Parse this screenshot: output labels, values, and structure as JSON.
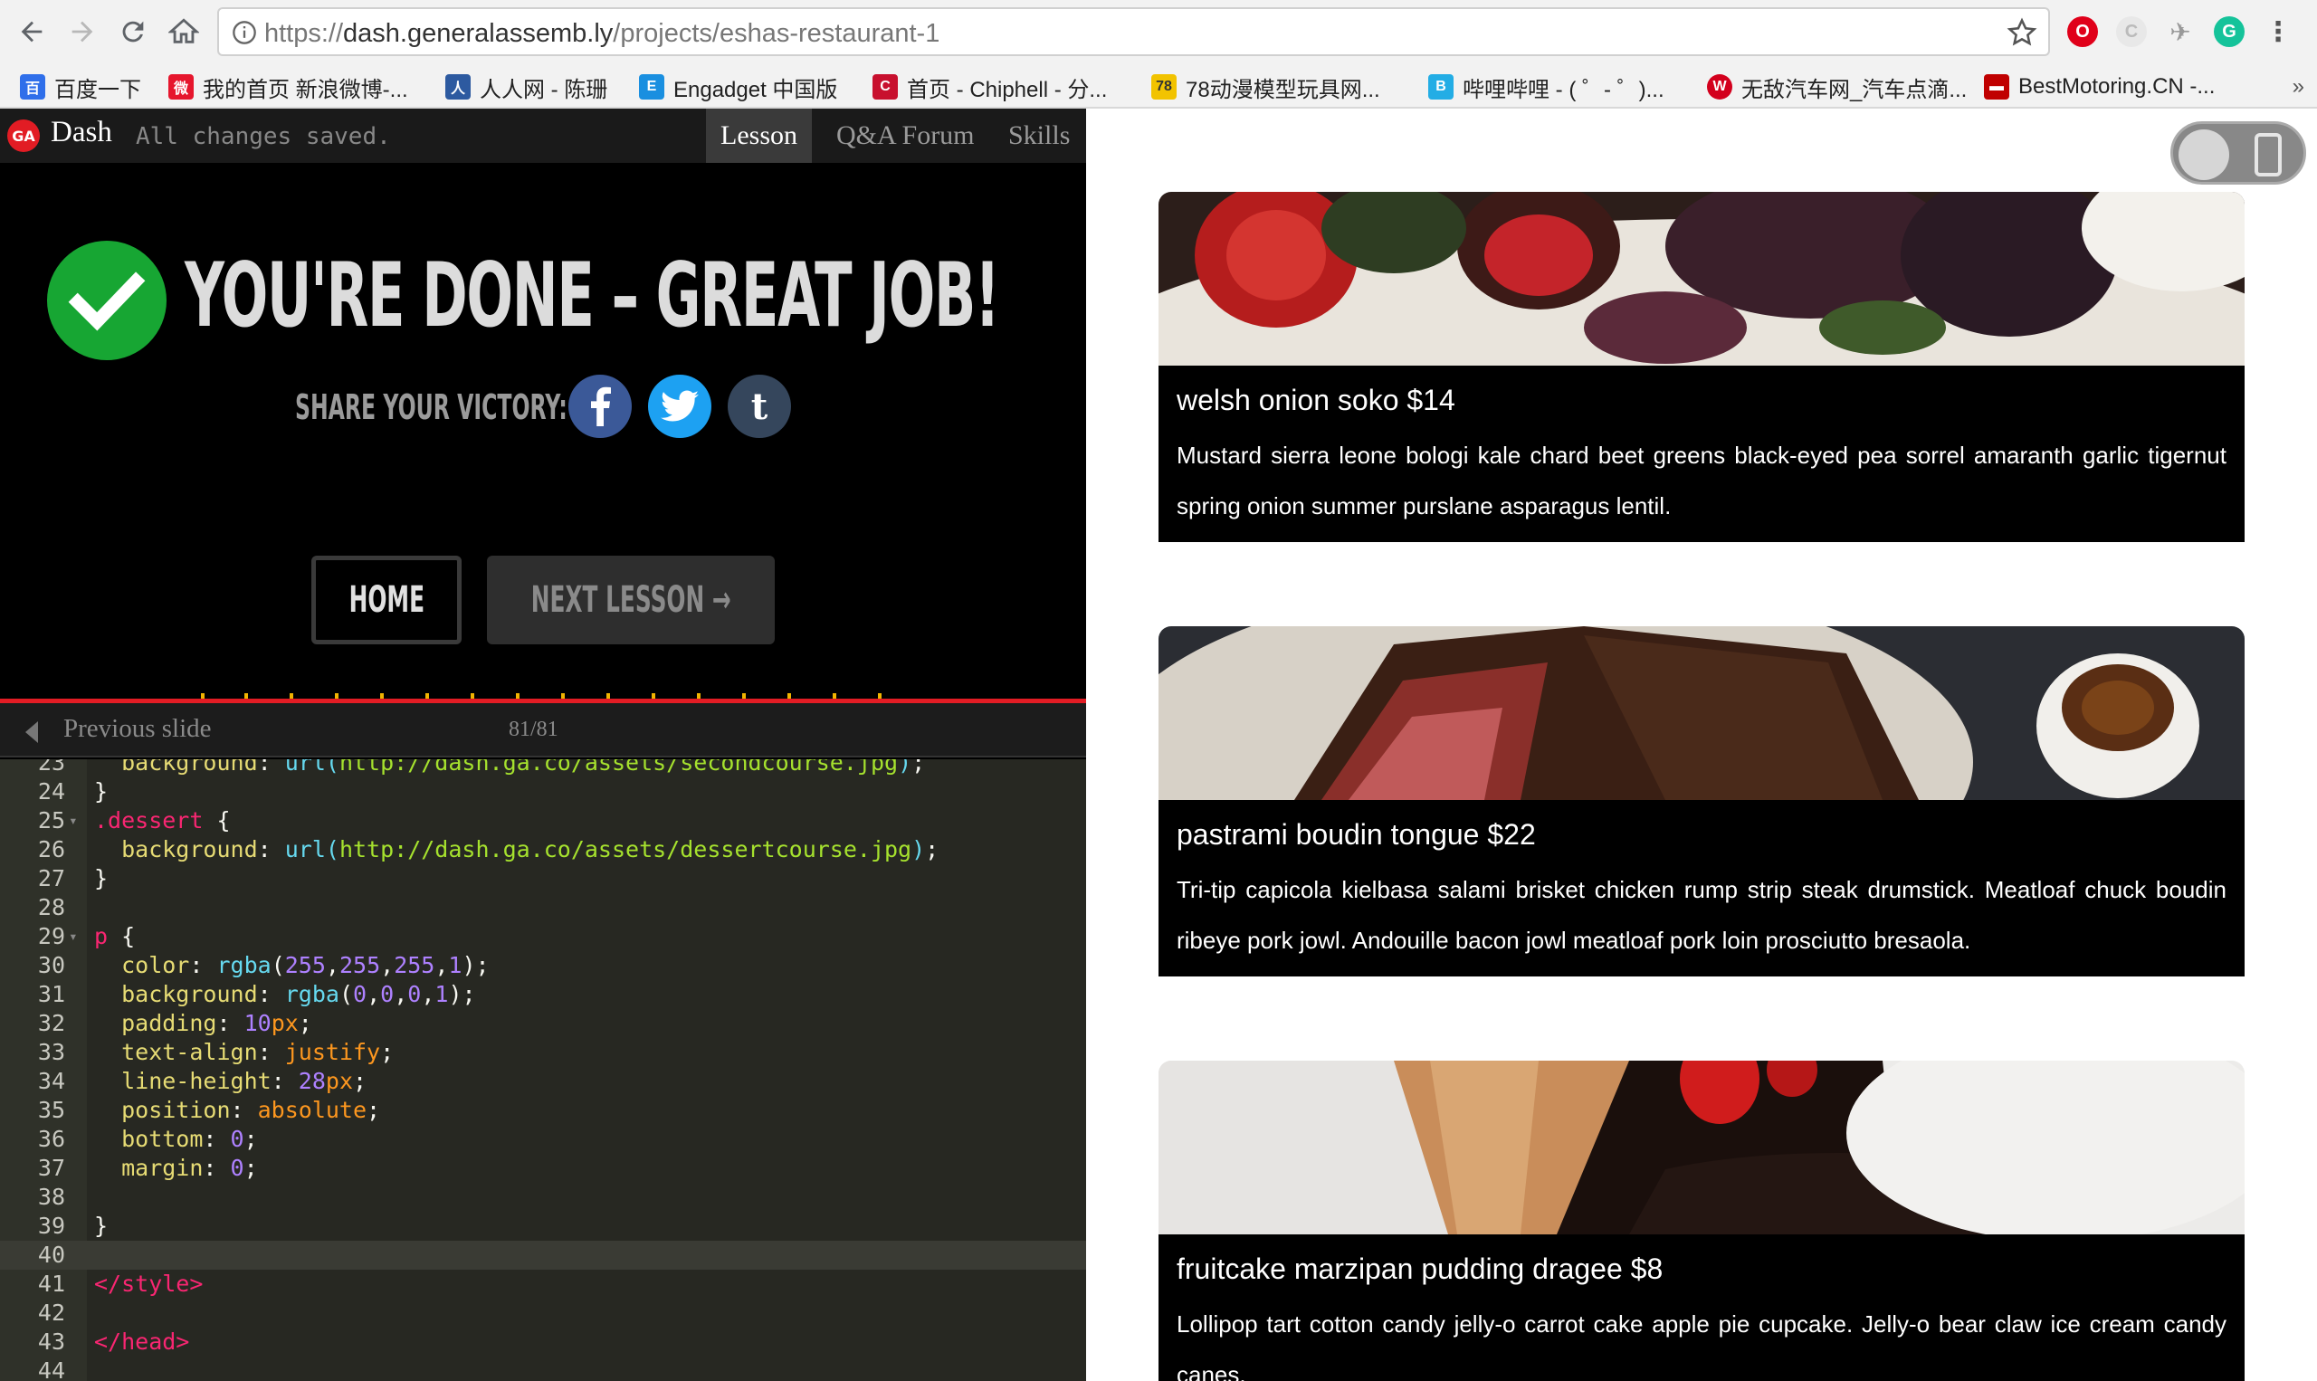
{
  "browser": {
    "url_prefix": "https://",
    "url_host": "dash.generalassemb.ly",
    "url_path": "/projects/eshas-restaurant-1"
  },
  "bookmarks": [
    {
      "label": "百度一下",
      "color": "#2f6fea"
    },
    {
      "label": "我的首页 新浪微博-...",
      "color": "#e6162d"
    },
    {
      "label": "人人网 - 陈珊",
      "color": "#2d5aa0"
    },
    {
      "label": "Engadget 中国版",
      "color": "#1a8fe0"
    },
    {
      "label": "首页 - Chiphell - 分...",
      "color": "#c8102e"
    },
    {
      "label": "78动漫模型玩具网...",
      "color": "#f2c300"
    },
    {
      "label": "哔哩哔哩 - ( ゜- ゜)...",
      "color": "#23ade5"
    },
    {
      "label": "无敌汽车网_汽车点滴...",
      "color": "#d3001d"
    },
    {
      "label": "BestMotoring.CN -...",
      "color": "#c00000"
    }
  ],
  "dash": {
    "logo": "GA",
    "title": "Dash",
    "status": "All changes saved.",
    "tabs": [
      "Lesson",
      "Q&A Forum",
      "Skills"
    ],
    "active_tab": "Lesson",
    "done_title": "YOU'RE DONE – GREAT JOB!",
    "share_label": "SHARE YOUR VICTORY:",
    "social": [
      "facebook",
      "twitter",
      "tumblr"
    ],
    "home_label": "HOME",
    "next_label": "NEXT LESSON →",
    "prev_label": "Previous slide",
    "slide_count": "81/81"
  },
  "code": {
    "active_line": "40",
    "lines": [
      {
        "n": "23",
        "fold": false,
        "tokens": [
          [
            "t-prop",
            "  background"
          ],
          [
            "t-plain",
            ": "
          ],
          [
            "t-fn",
            "url("
          ],
          [
            "t-str",
            "http://dash.ga.co/assets/secondcourse.jpg"
          ],
          [
            "t-fn",
            ")"
          ],
          [
            "t-plain",
            ";"
          ]
        ]
      },
      {
        "n": "24",
        "fold": false,
        "tokens": [
          [
            "t-plain",
            "}"
          ]
        ]
      },
      {
        "n": "25",
        "fold": true,
        "tokens": [
          [
            "t-sel",
            ".dessert"
          ],
          [
            "t-plain",
            " {"
          ]
        ]
      },
      {
        "n": "26",
        "fold": false,
        "tokens": [
          [
            "t-prop",
            "  background"
          ],
          [
            "t-plain",
            ": "
          ],
          [
            "t-fn",
            "url("
          ],
          [
            "t-str",
            "http://dash.ga.co/assets/dessertcourse.jpg"
          ],
          [
            "t-fn",
            ")"
          ],
          [
            "t-plain",
            ";"
          ]
        ]
      },
      {
        "n": "27",
        "fold": false,
        "tokens": [
          [
            "t-plain",
            "}"
          ]
        ]
      },
      {
        "n": "28",
        "fold": false,
        "tokens": []
      },
      {
        "n": "29",
        "fold": true,
        "tokens": [
          [
            "t-sel",
            "p"
          ],
          [
            "t-plain",
            " {"
          ]
        ]
      },
      {
        "n": "30",
        "fold": false,
        "tokens": [
          [
            "t-prop",
            "  color"
          ],
          [
            "t-plain",
            ": "
          ],
          [
            "t-fn",
            "rgba"
          ],
          [
            "t-plain",
            "("
          ],
          [
            "t-num",
            "255"
          ],
          [
            "t-plain",
            ","
          ],
          [
            "t-num",
            "255"
          ],
          [
            "t-plain",
            ","
          ],
          [
            "t-num",
            "255"
          ],
          [
            "t-plain",
            ","
          ],
          [
            "t-num",
            "1"
          ],
          [
            "t-plain",
            ");"
          ]
        ]
      },
      {
        "n": "31",
        "fold": false,
        "tokens": [
          [
            "t-prop",
            "  background"
          ],
          [
            "t-plain",
            ": "
          ],
          [
            "t-fn",
            "rgba"
          ],
          [
            "t-plain",
            "("
          ],
          [
            "t-num",
            "0"
          ],
          [
            "t-plain",
            ","
          ],
          [
            "t-num",
            "0"
          ],
          [
            "t-plain",
            ","
          ],
          [
            "t-num",
            "0"
          ],
          [
            "t-plain",
            ","
          ],
          [
            "t-num",
            "1"
          ],
          [
            "t-plain",
            ");"
          ]
        ]
      },
      {
        "n": "32",
        "fold": false,
        "tokens": [
          [
            "t-prop",
            "  padding"
          ],
          [
            "t-plain",
            ": "
          ],
          [
            "t-num",
            "10"
          ],
          [
            "t-kw",
            "px"
          ],
          [
            "t-plain",
            ";"
          ]
        ]
      },
      {
        "n": "33",
        "fold": false,
        "tokens": [
          [
            "t-prop",
            "  text-align"
          ],
          [
            "t-plain",
            ": "
          ],
          [
            "t-kw",
            "justify"
          ],
          [
            "t-plain",
            ";"
          ]
        ]
      },
      {
        "n": "34",
        "fold": false,
        "tokens": [
          [
            "t-prop",
            "  line-height"
          ],
          [
            "t-plain",
            ": "
          ],
          [
            "t-num",
            "28"
          ],
          [
            "t-kw",
            "px"
          ],
          [
            "t-plain",
            ";"
          ]
        ]
      },
      {
        "n": "35",
        "fold": false,
        "tokens": [
          [
            "t-prop",
            "  position"
          ],
          [
            "t-plain",
            ": "
          ],
          [
            "t-kw",
            "absolute"
          ],
          [
            "t-plain",
            ";"
          ]
        ]
      },
      {
        "n": "36",
        "fold": false,
        "tokens": [
          [
            "t-prop",
            "  bottom"
          ],
          [
            "t-plain",
            ": "
          ],
          [
            "t-num",
            "0"
          ],
          [
            "t-plain",
            ";"
          ]
        ]
      },
      {
        "n": "37",
        "fold": false,
        "tokens": [
          [
            "t-prop",
            "  margin"
          ],
          [
            "t-plain",
            ": "
          ],
          [
            "t-num",
            "0"
          ],
          [
            "t-plain",
            ";"
          ]
        ]
      },
      {
        "n": "38",
        "fold": false,
        "tokens": []
      },
      {
        "n": "39",
        "fold": false,
        "tokens": [
          [
            "t-plain",
            "}"
          ]
        ]
      },
      {
        "n": "40",
        "fold": false,
        "tokens": []
      },
      {
        "n": "41",
        "fold": false,
        "tokens": [
          [
            "t-sel",
            "</style>"
          ]
        ]
      },
      {
        "n": "42",
        "fold": false,
        "tokens": []
      },
      {
        "n": "43",
        "fold": false,
        "tokens": [
          [
            "t-sel",
            "</head>"
          ]
        ]
      },
      {
        "n": "44",
        "fold": false,
        "tokens": []
      }
    ]
  },
  "menu": [
    {
      "name": "welsh onion soko $14",
      "desc": "Mustard sierra leone bologi kale chard beet greens black-eyed pea sorrel amaranth garlic tigernut spring onion summer purslane asparagus lentil.",
      "photo": "salad"
    },
    {
      "name": "pastrami boudin tongue $22",
      "desc": "Tri-tip capicola kielbasa salami brisket chicken rump strip steak drumstick. Meatloaf chuck boudin ribeye pork jowl. Andouille bacon jowl meatloaf pork loin prosciutto bresaola.",
      "photo": "steak"
    },
    {
      "name": "fruitcake marzipan pudding dragee $8",
      "desc": "Lollipop tart cotton candy jelly-o carrot cake apple pie cupcake. Jelly-o bear claw ice cream candy canes.",
      "photo": "dessert"
    }
  ]
}
